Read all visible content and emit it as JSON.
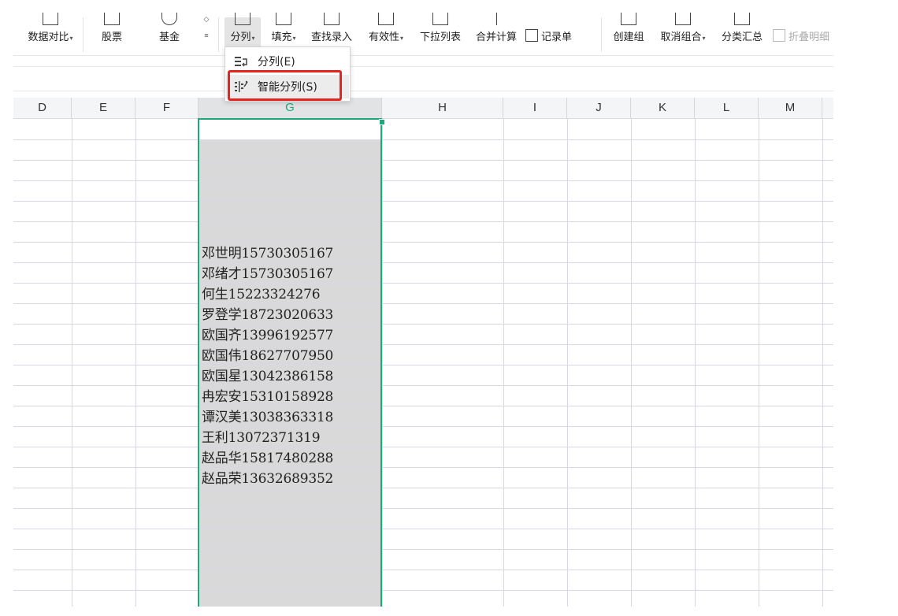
{
  "ribbon": {
    "items": [
      {
        "label": "数据对比",
        "caret": "▾"
      },
      {
        "label": "股票"
      },
      {
        "label": "基金"
      },
      {
        "label": "分列",
        "caret": "▾"
      },
      {
        "label": "填充",
        "caret": "▾"
      },
      {
        "label": "查找录入"
      },
      {
        "label": "有效性",
        "caret": "▾"
      },
      {
        "label": "下拉列表"
      },
      {
        "label": "合并计算"
      },
      {
        "label": "记录单"
      },
      {
        "label": "创建组"
      },
      {
        "label": "取消组合",
        "caret": "▾"
      },
      {
        "label": "分类汇总"
      },
      {
        "label": "折叠明细"
      }
    ]
  },
  "menu": {
    "items": [
      {
        "label": "分列(E)",
        "icon": "split-columns-icon"
      },
      {
        "label": "智能分列(S)",
        "icon": "smart-split-icon"
      }
    ]
  },
  "columns": [
    "D",
    "E",
    "F",
    "G",
    "H",
    "I",
    "J",
    "K",
    "L",
    "M"
  ],
  "selected_column": "G",
  "cells": [
    "邓世明15730305167",
    "邓绪才15730305167",
    "何生15223324276",
    "罗登学18723020633",
    "欧国齐13996192577",
    "欧国伟18627707950",
    "欧国星13042386158",
    "冉宏安15310158928",
    "谭汉美13038363318",
    "王利13072371319",
    "赵品华15817480288",
    "赵品荣13632689352"
  ],
  "colors": {
    "selection": "#1fa87a",
    "highlight": "#e8231f"
  }
}
